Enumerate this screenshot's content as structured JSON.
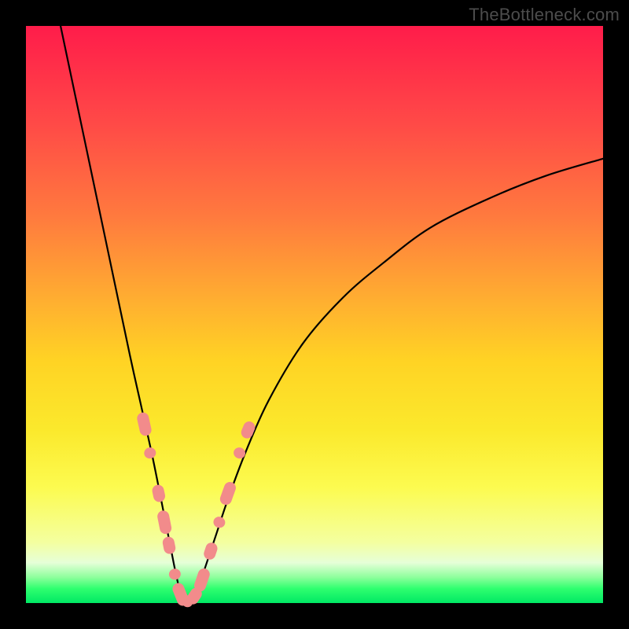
{
  "watermark": "TheBottleneck.com",
  "colors": {
    "curve_stroke": "#000000",
    "marker_fill": "#f28b8b",
    "marker_stroke": "#e06767",
    "frame": "#000000"
  },
  "chart_data": {
    "type": "line",
    "title": "",
    "xlabel": "",
    "ylabel": "",
    "xlim": [
      0,
      100
    ],
    "ylim": [
      0,
      100
    ],
    "note": "V-shaped curve with minimum near x≈27; left branch from (6,100) to trough near (27,0); right branch rises toward (100,77). Axes are unlabeled; values are estimated from geometry.",
    "series": [
      {
        "name": "curve",
        "x": [
          6,
          10,
          14,
          18,
          20,
          22,
          24,
          25,
          26,
          27,
          28,
          29,
          30,
          31,
          33,
          35,
          38,
          42,
          48,
          55,
          62,
          70,
          80,
          90,
          100
        ],
        "y": [
          100,
          81,
          62,
          43,
          34,
          25,
          15,
          10,
          5,
          1,
          0,
          1,
          3,
          6,
          12,
          18,
          26,
          35,
          45,
          53,
          59,
          65,
          70,
          74,
          77
        ]
      }
    ],
    "markers": {
      "name": "highlighted-points",
      "note": "Salmon oblong markers clustered near the trough on both branches",
      "points": [
        {
          "x": 20.5,
          "y": 31
        },
        {
          "x": 21.5,
          "y": 26
        },
        {
          "x": 23.0,
          "y": 19
        },
        {
          "x": 24.0,
          "y": 14
        },
        {
          "x": 24.8,
          "y": 10
        },
        {
          "x": 25.8,
          "y": 5
        },
        {
          "x": 26.8,
          "y": 1.5
        },
        {
          "x": 28.0,
          "y": 0.3
        },
        {
          "x": 29.2,
          "y": 1.2
        },
        {
          "x": 30.5,
          "y": 4
        },
        {
          "x": 32.0,
          "y": 9
        },
        {
          "x": 33.5,
          "y": 14
        },
        {
          "x": 35.0,
          "y": 19
        },
        {
          "x": 37.0,
          "y": 26
        },
        {
          "x": 38.5,
          "y": 30
        }
      ]
    }
  }
}
